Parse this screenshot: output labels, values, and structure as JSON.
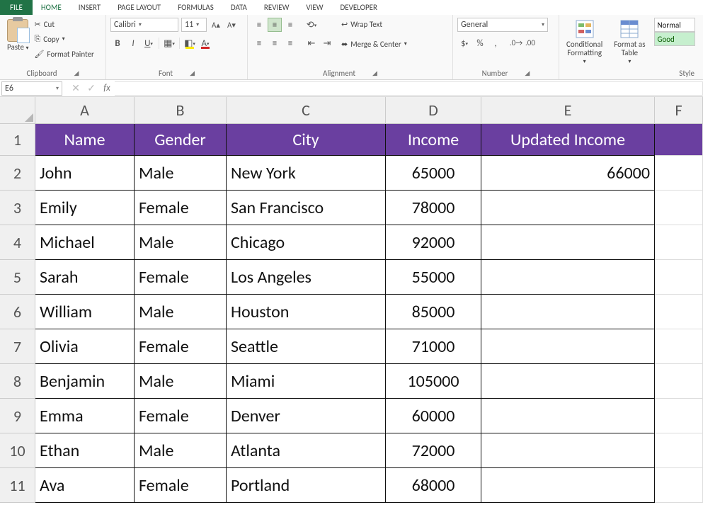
{
  "tabs": {
    "file": "FILE",
    "items": [
      "HOME",
      "INSERT",
      "PAGE LAYOUT",
      "FORMULAS",
      "DATA",
      "REVIEW",
      "VIEW",
      "DEVELOPER"
    ],
    "active": "HOME"
  },
  "ribbon": {
    "clipboard": {
      "paste": "Paste",
      "cut": "Cut",
      "copy": "Copy",
      "format_painter": "Format Painter",
      "group": "Clipboard"
    },
    "font": {
      "name": "Calibri",
      "size": "11",
      "group": "Font"
    },
    "alignment": {
      "wrap": "Wrap Text",
      "merge": "Merge & Center",
      "group": "Alignment"
    },
    "number": {
      "format": "General",
      "group": "Number"
    },
    "styles": {
      "conditional": "Conditional\nFormatting",
      "table": "Format as\nTable",
      "normal": "Normal",
      "good": "Good",
      "group": "Style"
    }
  },
  "fbar": {
    "name": "E6",
    "formula": ""
  },
  "columns": [
    "A",
    "B",
    "C",
    "D",
    "E",
    "F"
  ],
  "header_row": [
    "Name",
    "Gender",
    "City",
    "Income",
    "Updated Income"
  ],
  "rows": [
    {
      "n": "1"
    },
    {
      "n": "2",
      "a": "John",
      "b": "Male",
      "c": "New York",
      "d": "65000",
      "e": "66000"
    },
    {
      "n": "3",
      "a": "Emily",
      "b": "Female",
      "c": "San Francisco",
      "d": "78000",
      "e": ""
    },
    {
      "n": "4",
      "a": "Michael",
      "b": "Male",
      "c": "Chicago",
      "d": "92000",
      "e": ""
    },
    {
      "n": "5",
      "a": "Sarah",
      "b": "Female",
      "c": "Los Angeles",
      "d": "55000",
      "e": ""
    },
    {
      "n": "6",
      "a": "William",
      "b": "Male",
      "c": "Houston",
      "d": "85000",
      "e": ""
    },
    {
      "n": "7",
      "a": "Olivia",
      "b": "Female",
      "c": "Seattle",
      "d": "71000",
      "e": ""
    },
    {
      "n": "8",
      "a": "Benjamin",
      "b": "Male",
      "c": "Miami",
      "d": "105000",
      "e": ""
    },
    {
      "n": "9",
      "a": "Emma",
      "b": "Female",
      "c": "Denver",
      "d": "60000",
      "e": ""
    },
    {
      "n": "10",
      "a": "Ethan",
      "b": "Male",
      "c": "Atlanta",
      "d": "72000",
      "e": ""
    },
    {
      "n": "11",
      "a": "Ava",
      "b": "Female",
      "c": "Portland",
      "d": "68000",
      "e": ""
    }
  ]
}
